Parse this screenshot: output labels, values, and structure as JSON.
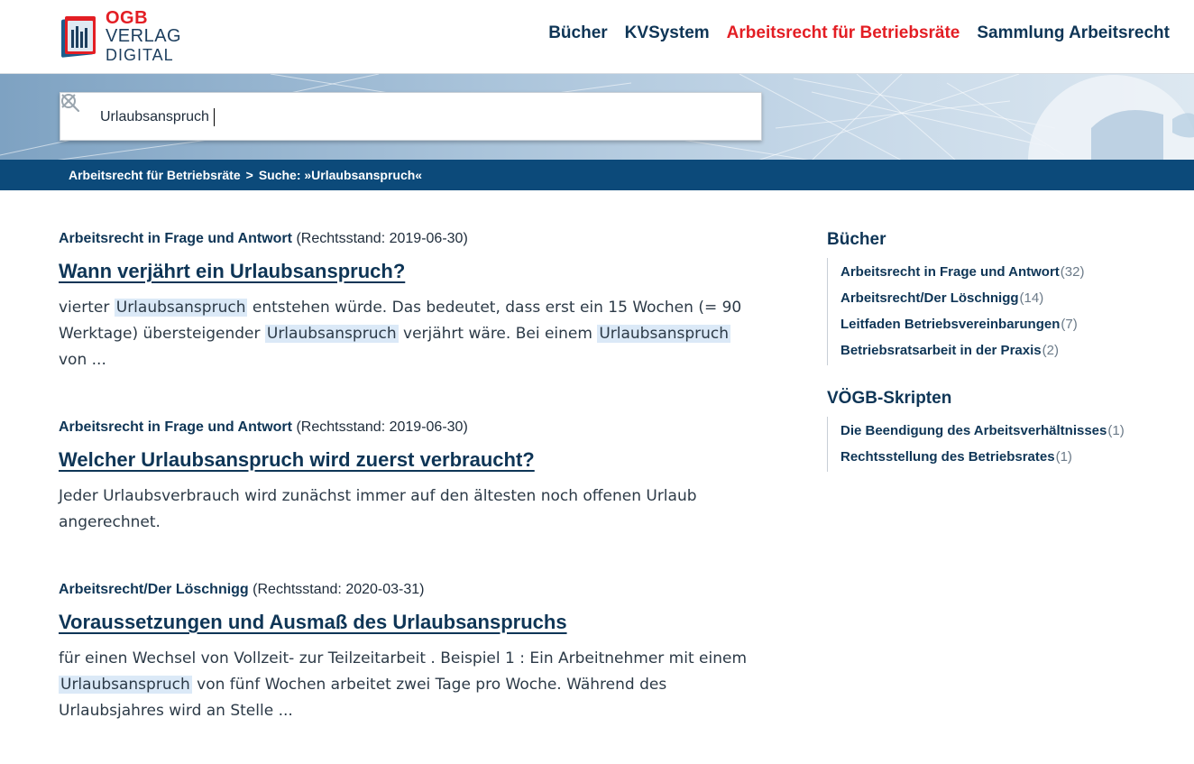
{
  "header": {
    "logo": {
      "line1_brand": "OGB",
      "line1_rest": "VERLAG",
      "line2": "DIGITAL"
    },
    "nav": [
      {
        "label": "Bücher",
        "active": false
      },
      {
        "label": "KVSystem",
        "active": false
      },
      {
        "label": "Arbeitsrecht für Betriebsräte",
        "active": true
      },
      {
        "label": "Sammlung Arbeitsrecht",
        "active": false
      }
    ]
  },
  "search": {
    "value": "Urlaubsanspruch"
  },
  "breadcrumb": {
    "items": [
      "Arbeitsrecht für Betriebsräte",
      "Suche: »Urlaubsanspruch«"
    ],
    "separator": ">"
  },
  "results": [
    {
      "book": "Arbeitsrecht in Frage und Antwort",
      "rechtsstand": "(Rechtsstand: 2019-06-30)",
      "title": "Wann verjährt ein Urlaubsanspruch?",
      "snippet": [
        {
          "t": "vierter "
        },
        {
          "t": "Urlaubsanspruch",
          "hl": true
        },
        {
          "t": " entstehen würde. Das bedeutet, dass erst ein 15 Wochen (= 90 Werktage) übersteigender "
        },
        {
          "t": "Urlaubsanspruch",
          "hl": true
        },
        {
          "t": " verjährt wäre. Bei einem "
        },
        {
          "t": "Urlaubsanspruch",
          "hl": true
        },
        {
          "t": " von ..."
        }
      ]
    },
    {
      "book": "Arbeitsrecht in Frage und Antwort",
      "rechtsstand": "(Rechtsstand: 2019-06-30)",
      "title": "Welcher Urlaubsanspruch wird zuerst verbraucht?",
      "snippet": [
        {
          "t": "Jeder Urlaubsverbrauch wird zunächst immer auf den ältesten noch offenen Urlaub angerechnet."
        }
      ]
    },
    {
      "book": "Arbeitsrecht/Der Löschnigg",
      "rechtsstand": "(Rechtsstand: 2020-03-31)",
      "title": "Voraussetzungen und Ausmaß des Urlaubsanspruchs",
      "snippet": [
        {
          "t": "für einen Wechsel von Vollzeit- zur Teilzeitarbeit . Beispiel 1 : Ein Arbeitnehmer mit einem "
        },
        {
          "t": "Urlaubsanspruch",
          "hl": true
        },
        {
          "t": " von fünf Wochen arbeitet zwei Tage pro Woche. Während des Urlaubsjahres wird an Stelle ..."
        }
      ]
    }
  ],
  "sidebar": {
    "facets": [
      {
        "title": "Bücher",
        "items": [
          {
            "label": "Arbeitsrecht in Frage und Antwort",
            "count": "(32)"
          },
          {
            "label": "Arbeitsrecht/Der Löschnigg",
            "count": "(14)"
          },
          {
            "label": "Leitfaden Betriebsvereinbarungen",
            "count": "(7)"
          },
          {
            "label": "Betriebsratsarbeit in der Praxis",
            "count": "(2)"
          }
        ]
      },
      {
        "title": "VÖGB-Skripten",
        "items": [
          {
            "label": "Die Beendigung des Arbeitsverhältnisses",
            "count": "(1)"
          },
          {
            "label": "Rechtsstellung des Betriebsrates",
            "count": "(1)"
          }
        ]
      }
    ]
  },
  "colors": {
    "brand_red": "#e31e24",
    "navy": "#0e3556",
    "breadcrumb_bg": "#0c4a7a",
    "highlight": "#dbe9f7"
  },
  "icons": {
    "search": "magnifier-icon",
    "clear": "close-icon"
  }
}
